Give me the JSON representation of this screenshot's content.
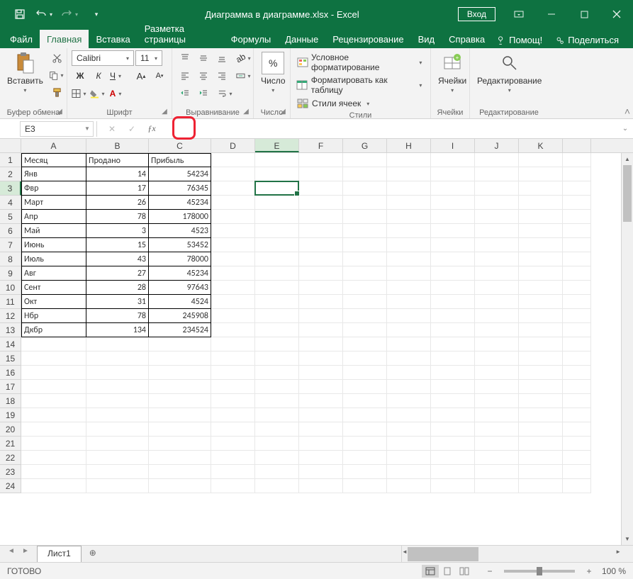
{
  "title": "Диаграмма в диаграмме.xlsx - Excel",
  "login": "Вход",
  "tabs": [
    "Файл",
    "Главная",
    "Вставка",
    "Разметка страницы",
    "Формулы",
    "Данные",
    "Рецензирование",
    "Вид",
    "Справка"
  ],
  "active_tab": 1,
  "help_hint": "Помощ!",
  "share": "Поделиться",
  "ribbon": {
    "clipboard": {
      "paste": "Вставить",
      "label": "Буфер обмена"
    },
    "font": {
      "name": "Calibri",
      "size": "11",
      "label": "Шрифт"
    },
    "align": {
      "label": "Выравнивание"
    },
    "number": {
      "big": "Число",
      "label": "Число"
    },
    "styles": {
      "cond": "Условное форматирование",
      "table": "Форматировать как таблицу",
      "cell": "Стили ячеек",
      "label": "Стили"
    },
    "cells": {
      "label": "Ячейки"
    },
    "edit": {
      "label": "Редактирование"
    }
  },
  "name_box": "E3",
  "formula": "",
  "columns": [
    "A",
    "B",
    "C",
    "D",
    "E",
    "F",
    "G",
    "H",
    "I",
    "J",
    "K"
  ],
  "headers": [
    "Месяц",
    "Продано",
    "Прибыль"
  ],
  "rows": [
    [
      "Янв",
      "14",
      "54234"
    ],
    [
      "Фвр",
      "17",
      "76345"
    ],
    [
      "Март",
      "26",
      "45234"
    ],
    [
      "Апр",
      "78",
      "178000"
    ],
    [
      "Май",
      "3",
      "4523"
    ],
    [
      "Июнь",
      "15",
      "53452"
    ],
    [
      "Июль",
      "43",
      "78000"
    ],
    [
      "Авг",
      "27",
      "45234"
    ],
    [
      "Сент",
      "28",
      "97643"
    ],
    [
      "Окт",
      "31",
      "4524"
    ],
    [
      "Нбр",
      "78",
      "245908"
    ],
    [
      "Дкбр",
      "134",
      "234524"
    ]
  ],
  "total_rows": 24,
  "active_cell": {
    "row": 3,
    "col": "E"
  },
  "sheet": "Лист1",
  "status": "ГОТОВО",
  "zoom": "100 %"
}
